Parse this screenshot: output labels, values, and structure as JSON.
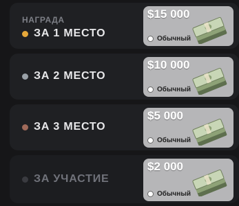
{
  "header_label": "НАГРАДА",
  "rewards": [
    {
      "place": "ЗА 1 МЕСТО",
      "dot_color": "#e6a83a",
      "amount": "$15 000",
      "rarity": "Обычный",
      "icon": "cash-stack-icon"
    },
    {
      "place": "ЗА 2 МЕСТО",
      "dot_color": "#9aa1a8",
      "amount": "$10 000",
      "rarity": "Обычный",
      "icon": "cash-stack-icon"
    },
    {
      "place": "ЗА 3 МЕСТО",
      "dot_color": "#a06a5a",
      "amount": "$5 000",
      "rarity": "Обычный",
      "icon": "cash-stack-icon"
    },
    {
      "place": "ЗА УЧАСТИЕ",
      "dot_color": "#3a3b40",
      "amount": "$2 000",
      "rarity": "Обычный",
      "icon": "cash-stack-icon"
    }
  ],
  "colors": {
    "background": "#161618",
    "row": "#1f2023",
    "prize_card": "#b6b6b8"
  }
}
